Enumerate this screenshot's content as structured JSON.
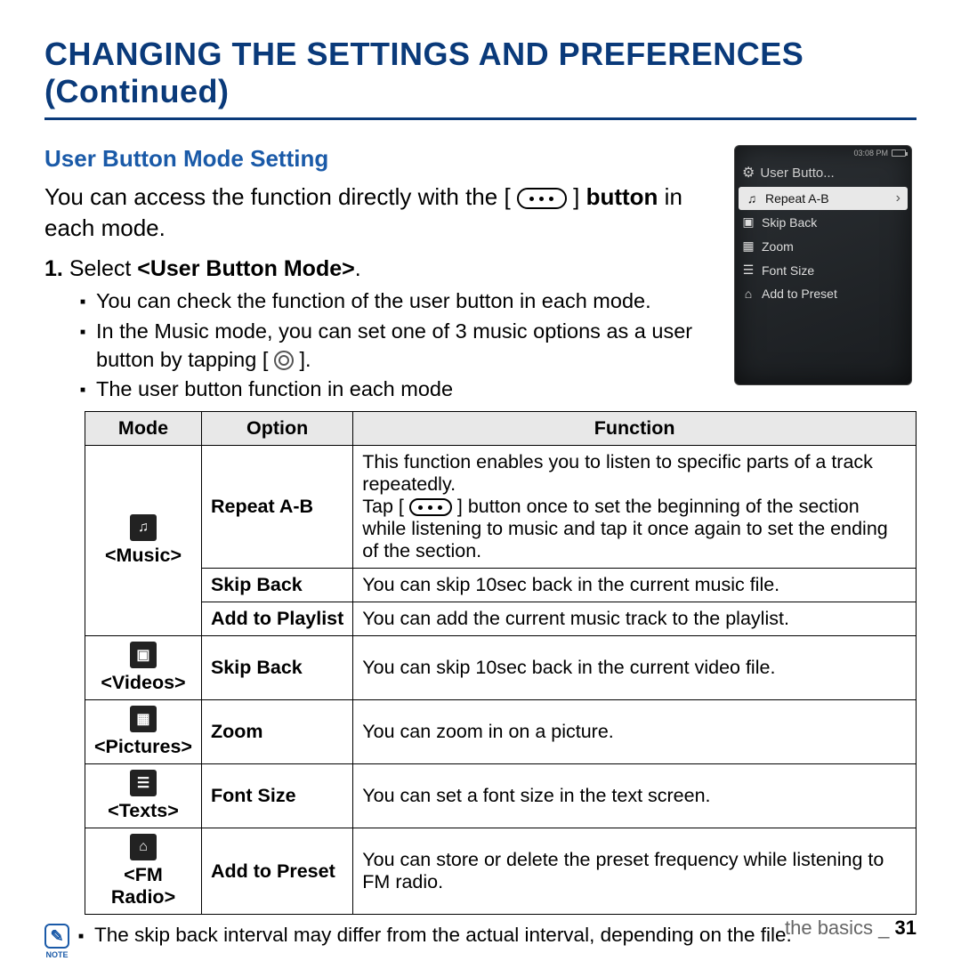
{
  "title": "CHANGING THE SETTINGS AND PREFERENCES (Continued)",
  "subheading": "User Button Mode Setting",
  "intro_pre": "You can access the function directly with the [ ",
  "intro_post_pre_bold": " ] ",
  "intro_bold": "button",
  "intro_post_bold": " in each mode.",
  "step_num": "1.",
  "step_text_pre": " Select ",
  "step_bold": "<User Button Mode>",
  "step_post": ".",
  "bullets": {
    "b1": "You can check the function of the user button in each mode.",
    "b2_a": "In the Music mode, you can set one of 3 music options as a user button by tapping [ ",
    "b2_b": " ].",
    "b3": "The user button function in each mode"
  },
  "table": {
    "headers": {
      "mode": "Mode",
      "option": "Option",
      "function": "Function"
    },
    "modes": {
      "music": "<Music>",
      "videos": "<Videos>",
      "pictures": "<Pictures>",
      "texts": "<Texts>",
      "fmradio": "<FM Radio>"
    },
    "rows": {
      "r1": {
        "option": "Repeat A-B",
        "func_a": "This function enables you to listen to specific parts of a track repeatedly.",
        "func_b_pre": "Tap [ ",
        "func_b_post": " ] button once to set the beginning of the section while listening to music and tap it once again to set the ending of the section."
      },
      "r2": {
        "option": "Skip Back",
        "func": "You can skip 10sec back in the current music file."
      },
      "r3": {
        "option": "Add to Playlist",
        "func": "You can add the current music track to the playlist."
      },
      "r4": {
        "option": "Skip Back",
        "func": "You can skip 10sec back in the current video file."
      },
      "r5": {
        "option": "Zoom",
        "func": "You can zoom in on a picture."
      },
      "r6": {
        "option": "Font Size",
        "func": "You can set a font size in the text screen."
      },
      "r7": {
        "option": "Add to Preset",
        "func": "You can store or delete the preset frequency while listening to FM radio."
      }
    }
  },
  "note_label": "NOTE",
  "note_text": "The skip back interval may differ from the actual interval, depending on the file.",
  "footer_section": "the basics _ ",
  "footer_page": "31",
  "device": {
    "time": "03:08 PM",
    "title": "User Butto...",
    "items": {
      "i1": "Repeat A-B",
      "i2": "Skip Back",
      "i3": "Zoom",
      "i4": "Font Size",
      "i5": "Add to Preset"
    }
  }
}
